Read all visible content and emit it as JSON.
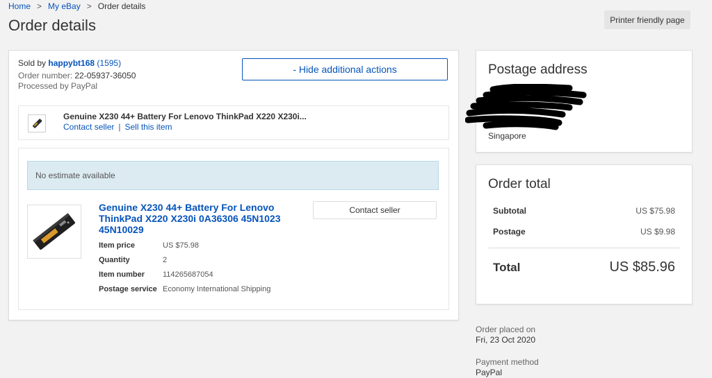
{
  "breadcrumb": {
    "home": "Home",
    "my_ebay": "My eBay",
    "current": "Order details",
    "separator": ">"
  },
  "page_title": "Order details",
  "printer_button": "Printer friendly page",
  "order": {
    "sold_by_label": "Sold by",
    "seller": "happybt168",
    "feedback_open": "(",
    "feedback_score": "1595",
    "feedback_close": ")",
    "order_number_label": "Order number:",
    "order_number": "22-05937-36050",
    "processed_by": "Processed by PayPal",
    "hide_actions_label": "- Hide additional actions"
  },
  "item_strip": {
    "title": "Genuine X230 44+ Battery For Lenovo ThinkPad X220 X230i...",
    "contact_seller": "Contact seller",
    "separator": "|",
    "sell_this_item": "Sell this item"
  },
  "item_detail": {
    "estimate_text": "No estimate available",
    "title": "Genuine X230 44+ Battery For Lenovo ThinkPad X220 X230i 0A36306 45N1023 45N10029",
    "contact_button": "Contact seller",
    "props": [
      {
        "label": "Item price",
        "value": "US $75.98"
      },
      {
        "label": "Quantity",
        "value": "2"
      },
      {
        "label": "Item number",
        "value": "114265687054"
      },
      {
        "label": "Postage service",
        "value": "Economy International Shipping"
      }
    ]
  },
  "postage_address": {
    "heading": "Postage address",
    "country": "Singapore"
  },
  "order_total": {
    "heading": "Order total",
    "subtotal_label": "Subtotal",
    "subtotal_value": "US $75.98",
    "postage_label": "Postage",
    "postage_value": "US $9.98",
    "total_label": "Total",
    "total_value": "US $85.96"
  },
  "order_meta": {
    "placed_label": "Order placed on",
    "placed_value": "Fri, 23 Oct 2020",
    "payment_label": "Payment method",
    "payment_value": "PayPal"
  },
  "colors": {
    "link": "#0654ba",
    "estimate_bg": "#dcebf2",
    "page_bg": "#f2f2f2"
  }
}
